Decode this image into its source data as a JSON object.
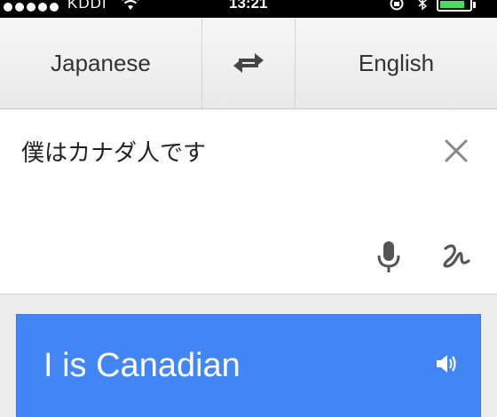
{
  "status_bar": {
    "carrier": "KDDI",
    "time": "13:21",
    "battery_level": 0.85,
    "signal_dots": 5
  },
  "language_bar": {
    "source_language": "Japanese",
    "target_language": "English"
  },
  "input": {
    "text": "僕はカナダ人です"
  },
  "result": {
    "translation": "I is Canadian"
  },
  "colors": {
    "result_background": "#4285f4",
    "battery_fill": "#4cd964"
  }
}
